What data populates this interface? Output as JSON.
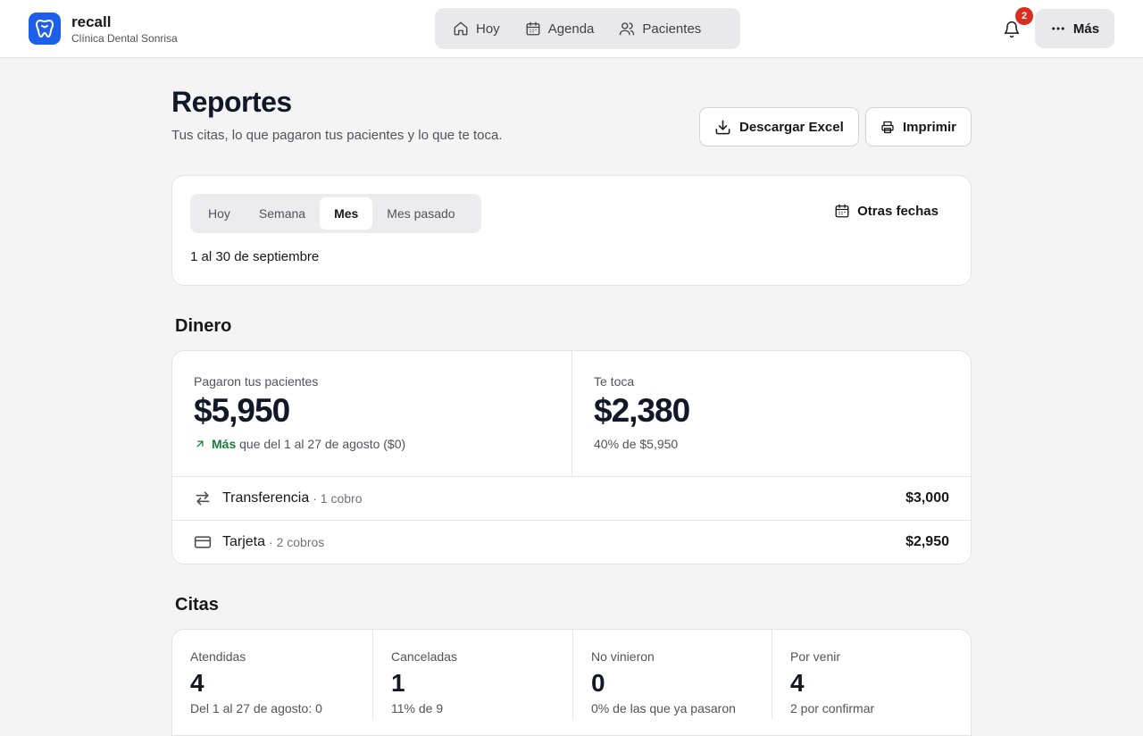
{
  "brand": {
    "name": "recall",
    "clinic": "Clínica Dental Sonrisa"
  },
  "nav": [
    {
      "label": "Hoy",
      "icon": "home-icon"
    },
    {
      "label": "Agenda",
      "icon": "calendar-icon"
    },
    {
      "label": "Pacientes",
      "icon": "users-icon"
    }
  ],
  "notifications": {
    "count": "2"
  },
  "more": {
    "label": "Más"
  },
  "page": {
    "title": "Reportes",
    "subtitle": "Tus citas, lo que pagaron tus pacientes y lo que te toca.",
    "download_label": "Descargar Excel",
    "print_label": "Imprimir"
  },
  "period": {
    "tabs": [
      "Hoy",
      "Semana",
      "Mes",
      "Mes pasado"
    ],
    "active": "Mes",
    "other_dates": "Otras fechas",
    "range": "1 al 30 de septiembre"
  },
  "money": {
    "title": "Dinero",
    "paid_label": "Pagaron tus pacientes",
    "paid_value": "$5,950",
    "compare_highlight": "Más",
    "compare_text": "que del 1 al 27 de agosto ($0)",
    "share_label": "Te toca",
    "share_value": "$2,380",
    "share_note": "40% de $5,950",
    "methods": [
      {
        "name": "Transferencia",
        "count": "· 1 cobro",
        "amount": "$3,000",
        "icon": "transfer-icon"
      },
      {
        "name": "Tarjeta",
        "count": "· 2 cobros",
        "amount": "$2,950",
        "icon": "card-icon"
      }
    ]
  },
  "appointments": {
    "title": "Citas",
    "stats": [
      {
        "label": "Atendidas",
        "value": "4",
        "note": "Del 1 al 27 de agosto: 0"
      },
      {
        "label": "Canceladas",
        "value": "1",
        "note": "11% de 9"
      },
      {
        "label": "No vinieron",
        "value": "0",
        "note": "0% de las que ya pasaron"
      },
      {
        "label": "Por venir",
        "value": "4",
        "note": "2 por confirmar"
      }
    ]
  },
  "colors": {
    "accent": "#1d5fe8",
    "positive": "#15803d",
    "badge": "#d92d20"
  }
}
